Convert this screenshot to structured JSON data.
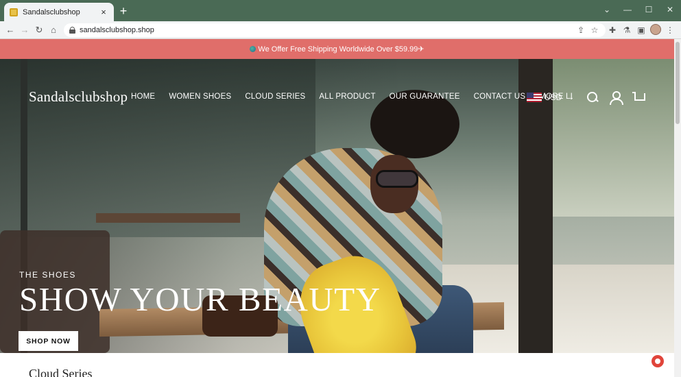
{
  "browser": {
    "tab_title": "Sandalsclubshop",
    "tab_close": "×",
    "new_tab": "+",
    "url": "sandalsclubshop.shop",
    "window_controls": [
      "⌄",
      "—",
      "☐",
      "✕"
    ]
  },
  "announcement": {
    "text": "We Offer Free Shipping Worldwide Over $59.99✈",
    "bg_color": "#e06e6a"
  },
  "header": {
    "logo": "Sandalsclubshop",
    "nav": [
      "HOME",
      "WOMEN SHOES",
      "CLOUD SERIES",
      "ALL PRODUCT",
      "OUR GUARANTEE",
      "CONTACT US",
      "MORE LI"
    ],
    "currency": "USD",
    "icons": [
      "search-icon",
      "account-icon",
      "cart-icon"
    ]
  },
  "hero": {
    "eyebrow": "THE SHOES",
    "headline": "SHOW YOUR BEAUTY",
    "cta": "SHOP NOW"
  },
  "below": {
    "section_title": "Cloud Series"
  }
}
